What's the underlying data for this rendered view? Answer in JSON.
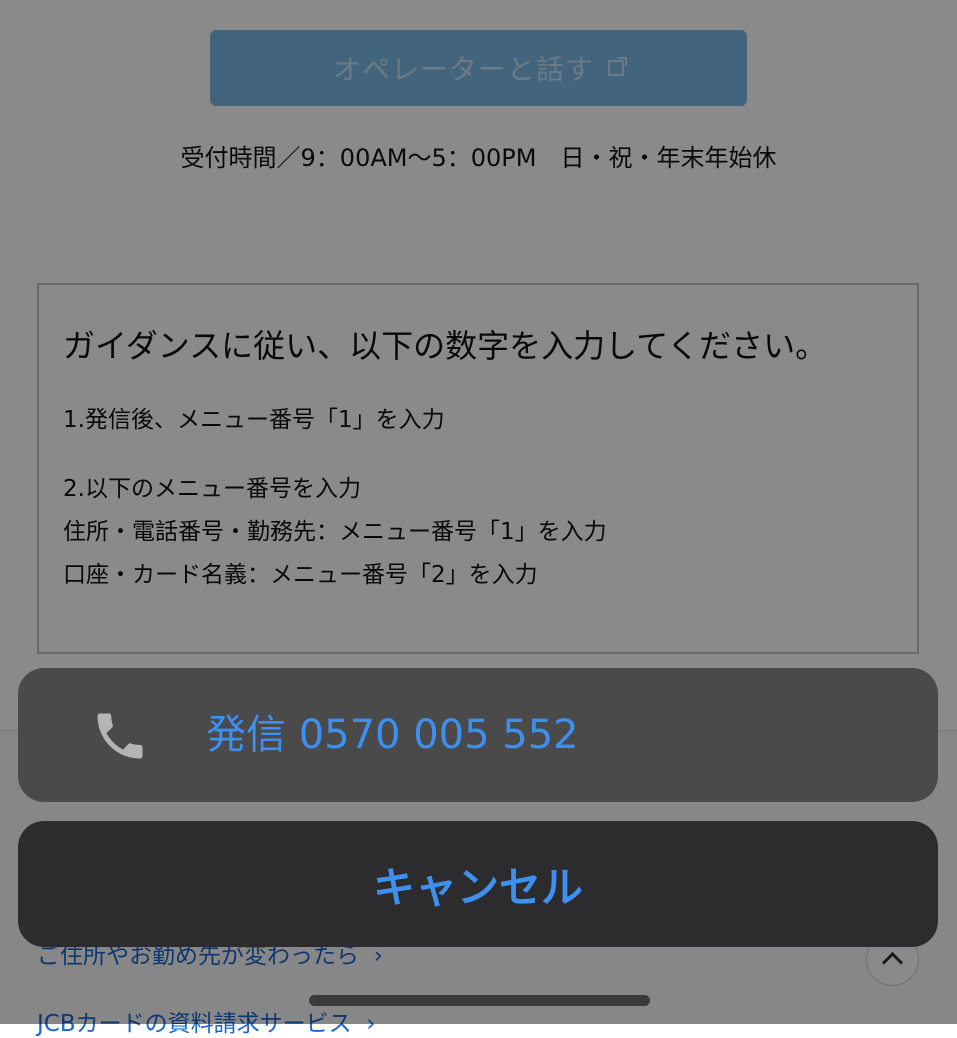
{
  "page": {
    "operator_button_label": "オペレーターと話す",
    "hours_text": "受付時間／9：00AM〜5：00PM　日・祝・年末年始休",
    "guide": {
      "title": "ガイダンスに従い、以下の数字を入力してください。",
      "step1": "1.発信後、メニュー番号「1」を入力",
      "step2": "2.以下のメニュー番号を入力",
      "step2_item1": "住所・電話番号・勤務先：メニュー番号「1」を入力",
      "step2_item2": "口座・カード名義：メニュー番号「2」を入力"
    },
    "footer_links": [
      "ご住所やお勤め先が変わったら",
      "JCBカードの資料請求サービス"
    ]
  },
  "action_sheet": {
    "call_label": "発信 0570 005 552",
    "cancel_label": "キャンセル"
  },
  "colors": {
    "accent": "#3d8ff0",
    "operator_button": "#7bbbe8",
    "sheet_dark": "#4a4a4a",
    "cancel_dark": "#2c2c2e"
  },
  "icons": [
    "external-link-icon",
    "phone-icon",
    "chevron-right-icon",
    "chevron-up-icon"
  ]
}
